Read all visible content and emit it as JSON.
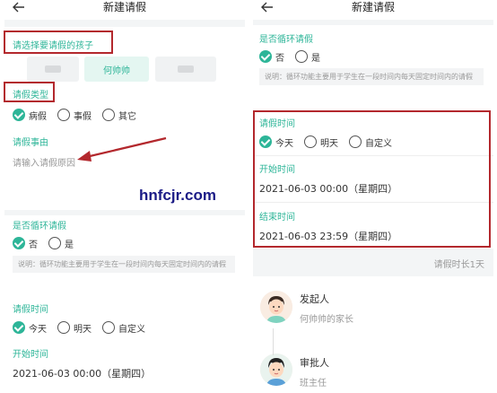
{
  "left": {
    "nav_title": "新建请假",
    "child_label": "请选择要请假的孩子",
    "children": [
      "何帅帅"
    ],
    "leave_type_label": "请假类型",
    "leave_types": [
      "病假",
      "事假",
      "其它"
    ],
    "reason_label": "请假事由",
    "reason_placeholder": "请输入请假原因",
    "recurring_label": "是否循环请假",
    "recurring_options": [
      "否",
      "是"
    ],
    "recurring_note": "说明：循环功能主要用于学生在一段时间内每天固定时间内的请假",
    "time_label": "请假时间",
    "time_options": [
      "今天",
      "明天",
      "自定义"
    ],
    "start_label": "开始时间",
    "start_value": "2021-06-03 00:00（星期四）"
  },
  "right": {
    "nav_title": "新建请假",
    "recurring_label": "是否循环请假",
    "recurring_options": [
      "否",
      "是"
    ],
    "recurring_note": "说明：循环功能主要用于学生在一段时间内每天固定时间内的请假",
    "time_label": "请假时间",
    "time_options": [
      "今天",
      "明天",
      "自定义"
    ],
    "start_label": "开始时间",
    "start_value": "2021-06-03 00:00（星期四）",
    "end_label": "结束时间",
    "end_value": "2021-06-03 23:59（星期四）",
    "duration": "请假时长1天",
    "initiator_role": "发起人",
    "initiator_name": "何帅帅的家长",
    "approver_role": "审批人",
    "approver_name": "班主任"
  },
  "watermark": "hnfcjr.com",
  "colors": {
    "accent": "#2db598",
    "annotation": "#b3282d"
  }
}
